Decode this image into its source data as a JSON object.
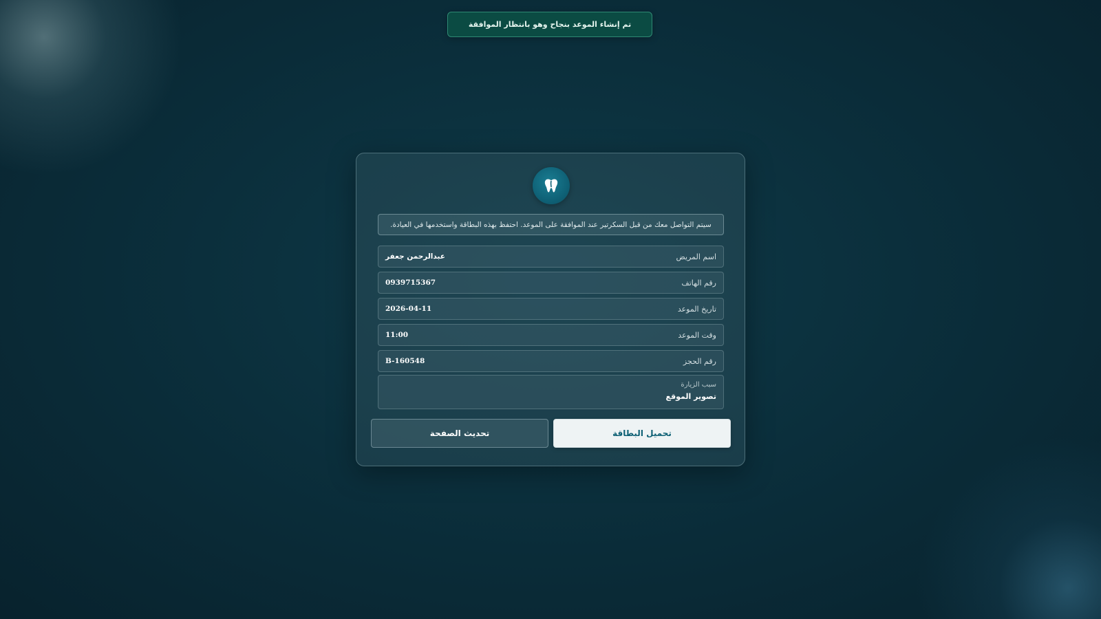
{
  "toast": {
    "message": "تم إنشاء الموعد بنجاح وهو بانتظار الموافقة"
  },
  "card": {
    "notice": "سيتم التواصل معك من قبل السكرتير عند الموافقة على الموعد. احتفظ بهذه البطاقة واستخدمها في العيادة.",
    "fields": [
      {
        "label": "اسم المريض",
        "value": "عبدالرحمن جعفر"
      },
      {
        "label": "رقم الهاتف",
        "value": "0939715367"
      },
      {
        "label": "تاريخ الموعد",
        "value": "2026-04-11"
      },
      {
        "label": "وقت الموعد",
        "value": "11:00"
      },
      {
        "label": "رقم الحجز",
        "value": "B-160548"
      }
    ],
    "reason": {
      "label": "سبب الزيارة",
      "value": "تصوير الموقع"
    },
    "buttons": {
      "download": "تحميل البطاقة",
      "refresh": "تحديث الصفحة"
    }
  },
  "colors": {
    "accent": "#0c5f73",
    "toast_bg": "#0b4b43",
    "toast_border": "#2f8a74"
  },
  "icons": {
    "logo": "tooth-logo-icon"
  }
}
